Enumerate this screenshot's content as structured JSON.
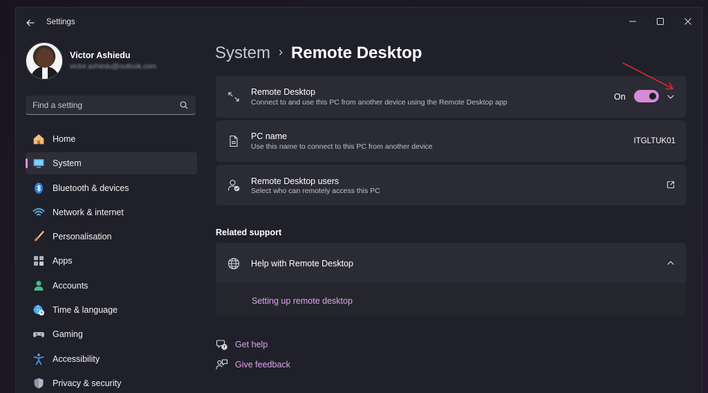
{
  "window": {
    "app_title": "Settings"
  },
  "profile": {
    "name": "Victor Ashiedu",
    "email": "victor.ashiedu@outlook.com"
  },
  "search": {
    "placeholder": "Find a setting"
  },
  "sidebar": {
    "items": [
      {
        "label": "Home",
        "icon": "home-icon",
        "active": false
      },
      {
        "label": "System",
        "icon": "system-icon",
        "active": true
      },
      {
        "label": "Bluetooth & devices",
        "icon": "bluetooth-icon",
        "active": false
      },
      {
        "label": "Network & internet",
        "icon": "wifi-icon",
        "active": false
      },
      {
        "label": "Personalisation",
        "icon": "brush-icon",
        "active": false
      },
      {
        "label": "Apps",
        "icon": "apps-icon",
        "active": false
      },
      {
        "label": "Accounts",
        "icon": "accounts-icon",
        "active": false
      },
      {
        "label": "Time & language",
        "icon": "globe-clock-icon",
        "active": false
      },
      {
        "label": "Gaming",
        "icon": "gamepad-icon",
        "active": false
      },
      {
        "label": "Accessibility",
        "icon": "accessibility-icon",
        "active": false
      },
      {
        "label": "Privacy & security",
        "icon": "shield-icon",
        "active": false
      }
    ]
  },
  "breadcrumb": {
    "parent": "System",
    "separator": "›",
    "current": "Remote Desktop"
  },
  "remote_desktop": {
    "title": "Remote Desktop",
    "description": "Connect to and use this PC from another device using the Remote Desktop app",
    "toggle_label": "On",
    "toggle_on": true
  },
  "pc_name": {
    "title": "PC name",
    "description": "Use this name to connect to this PC from another device",
    "value": "ITGLTUK01"
  },
  "rd_users": {
    "title": "Remote Desktop users",
    "description": "Select who can remotely access this PC"
  },
  "related_support": {
    "heading": "Related support",
    "help_title": "Help with Remote Desktop",
    "link": "Setting up remote desktop"
  },
  "footer": {
    "get_help": "Get help",
    "give_feedback": "Give feedback"
  },
  "colors": {
    "accent": "#d58bd6",
    "link": "#d9a6e6",
    "card": "#2b2b35",
    "window_bg": "#20202a",
    "annotation_arrow": "#d62828"
  }
}
